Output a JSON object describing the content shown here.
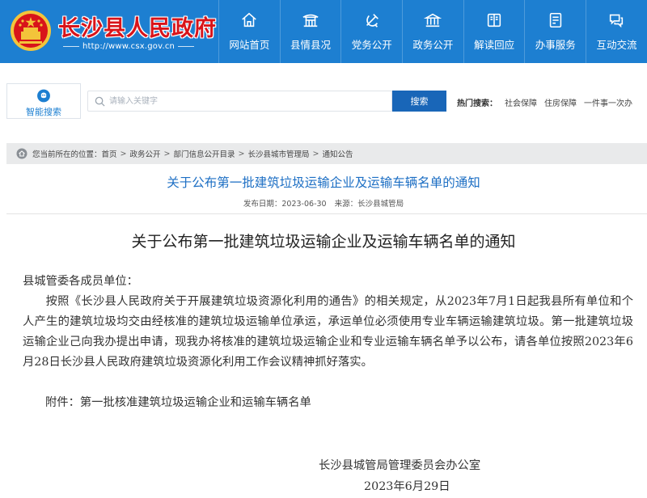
{
  "header": {
    "site_name": "长沙县人民政府",
    "site_url": "http://www.csx.gov.cn",
    "brand_color": "#1d7fd1",
    "name_color": "#d8141a"
  },
  "nav": {
    "items": [
      {
        "label": "网站首页",
        "icon": "home-icon"
      },
      {
        "label": "县情县况",
        "icon": "pavilion-icon"
      },
      {
        "label": "党务公开",
        "icon": "party-emblem-icon"
      },
      {
        "label": "政务公开",
        "icon": "government-building-icon"
      },
      {
        "label": "解读回应",
        "icon": "book-icon"
      },
      {
        "label": "办事服务",
        "icon": "document-edit-icon"
      },
      {
        "label": "互动交流",
        "icon": "chat-icon"
      }
    ]
  },
  "search": {
    "smart_label": "智能搜索",
    "placeholder": "请输入关键字",
    "button_label": "搜索",
    "hot_label": "热门搜索：",
    "hot_words": [
      "社会保障",
      "住房保障",
      "一件事一次办"
    ]
  },
  "breadcrumb": {
    "prefix": "您当前所在的位置：",
    "items": [
      "首页",
      "政务公开",
      "部门信息公开目录",
      "长沙县城市管理局",
      "通知公告"
    ]
  },
  "article": {
    "headline": "关于公布第一批建筑垃圾运输企业及运输车辆名单的通知",
    "publish_date": "发布日期：2023-06-30",
    "source": "来源：长沙县城管局",
    "title": "关于公布第一批建筑垃圾运输企业及运输车辆名单的通知",
    "salutation": "县城管委各成员单位：",
    "paragraph": "按照《长沙县人民政府关于开展建筑垃圾资源化利用的通告》的相关规定，从2023年7月1日起我县所有单位和个人产生的建筑垃圾均交由经核准的建筑垃圾运输单位承运，承运单位必须使用专业车辆运输建筑垃圾。第一批建筑垃圾运输企业己向我办提出申请，现我办将核准的建筑垃圾运输企业和专业运输车辆名单予以公布，请各单位按照2023年6月28日长沙县人民政府建筑垃圾资源化利用工作会议精神抓好落实。",
    "attachment": "附件：第一批核准建筑垃圾运输企业和运输车辆名单",
    "signature": "长沙县城管局管理委员会办公室",
    "date": "2023年6月29日"
  }
}
